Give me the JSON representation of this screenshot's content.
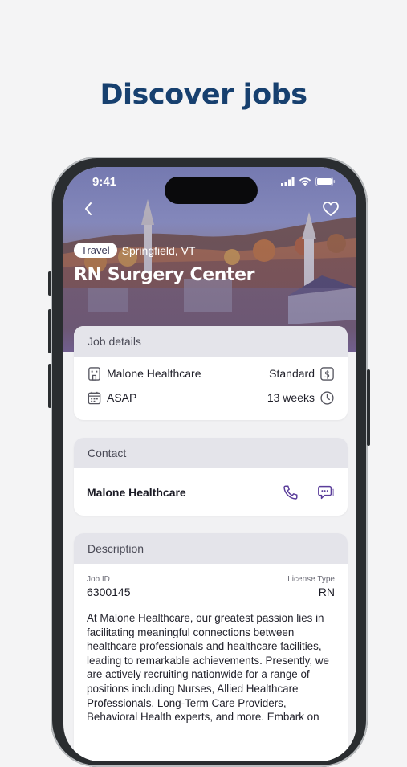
{
  "headline": "Discover jobs",
  "status_bar": {
    "time": "9:41"
  },
  "hero": {
    "tag": "Travel",
    "location": "Springfield, VT",
    "title": "RN Surgery Center"
  },
  "job_details": {
    "header": "Job details",
    "employer": "Malone Healthcare",
    "pay_type": "Standard",
    "start": "ASAP",
    "duration": "13 weeks"
  },
  "contact": {
    "header": "Contact",
    "name": "Malone Healthcare"
  },
  "description": {
    "header": "Description",
    "job_id_label": "Job ID",
    "job_id": "6300145",
    "license_label": "License Type",
    "license": "RN",
    "text": "At Malone Healthcare, our greatest passion lies in facilitating meaningful connections between healthcare professionals and healthcare facilities, leading to remarkable achievements. Presently, we are actively recruiting nationwide for a range of positions including Nurses, Allied Healthcare Professionals, Long-Term Care Providers, Behavioral Health experts, and more. Embark on"
  },
  "colors": {
    "brand": "#17406f",
    "accent": "#5a3d9a",
    "card_header": "#e4e4ea"
  },
  "icons": [
    "chevron-left-icon",
    "heart-icon",
    "building-icon",
    "dollar-icon",
    "calendar-icon",
    "clock-icon",
    "phone-icon",
    "chat-icon"
  ]
}
